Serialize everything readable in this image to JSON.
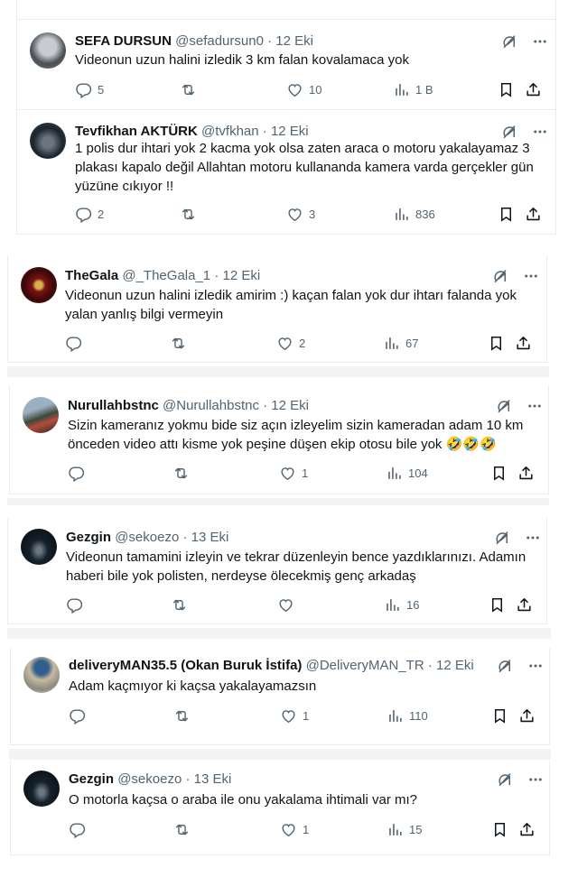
{
  "tweets": [
    {
      "name": "SEFA DURSUN",
      "handle": "@sefadursun0",
      "date": "· 12 Eki",
      "text": "Videonun uzun halini izledik 3 km falan kovalamaca yok",
      "replies": "5",
      "retweets": "",
      "likes": "10",
      "views": "1 B",
      "avatar_color": "#9aa3ab"
    },
    {
      "name": "Tevfikhan AKTÜRK",
      "handle": "@tvfkhan",
      "date": "· 12 Eki",
      "text": "1 polis dur ihtari yok 2 kacma yok olsa zaten araca o motoru yakalayamaz 3 plakası kapalo değil Allahtan motoru kullananda kamera varda gerçekler gün yüzüne cıkıyor !!",
      "replies": "2",
      "retweets": "",
      "likes": "3",
      "views": "836",
      "avatar_color": "#2e3a44"
    },
    {
      "name": "TheGala",
      "handle": "@_TheGala_1",
      "date": "· 12 Eki",
      "text": "Videonun uzun halini izledik amirim :) kaçan falan yok dur ihtarı falanda yok yalan yanlış bilgi vermeyin",
      "replies": "",
      "retweets": "",
      "likes": "2",
      "views": "67",
      "avatar_color": "#5a0c0c"
    },
    {
      "name": "Nurullahbstnc",
      "handle": "@Nurullahbstnc",
      "date": "· 12 Eki",
      "text": "Sizin kameranız yokmu bide siz açın izleyelim sizin kameradan adam 10 km önceden video attı kisme yok peşine düşen ekip otosu bile yok 🤣🤣🤣",
      "replies": "",
      "retweets": "",
      "likes": "1",
      "views": "104",
      "avatar_color": "#5f6f5a"
    },
    {
      "name": "Gezgin",
      "handle": "@sekoezo",
      "date": "· 13 Eki",
      "text": "Videonun tamamini izleyin ve tekrar düzenleyin bence yazdıklarınızı. Adamın haberi bile yok polisten, nerdeyse ölecekmiş genç arkadaş",
      "replies": "",
      "retweets": "",
      "likes": "",
      "views": "16",
      "avatar_color": "#0c1620"
    },
    {
      "name": "deliveryMAN35.5 (Okan Buruk İstifa)",
      "handle": "@DeliveryMAN_TR",
      "date": "· 12 Eki",
      "text": "Adam kaçmıyor ki kaçsa yakalayamazsın",
      "replies": "",
      "retweets": "",
      "likes": "1",
      "views": "110",
      "avatar_color": "#8a9a8f"
    },
    {
      "name": "Gezgin",
      "handle": "@sekoezo",
      "date": "· 13 Eki",
      "text": "O motorla kaçsa o araba ile onu yakalama ihtimali var mı?",
      "replies": "",
      "retweets": "",
      "likes": "1",
      "views": "15",
      "avatar_color": "#0c1620"
    }
  ],
  "colors": {
    "text": "#0f1419",
    "muted": "#536471",
    "border": "#e6ecf0"
  },
  "icons": [
    "reply-icon",
    "retweet-icon",
    "like-icon",
    "views-icon",
    "bookmark-icon",
    "share-icon",
    "grok-icon",
    "more-icon"
  ]
}
